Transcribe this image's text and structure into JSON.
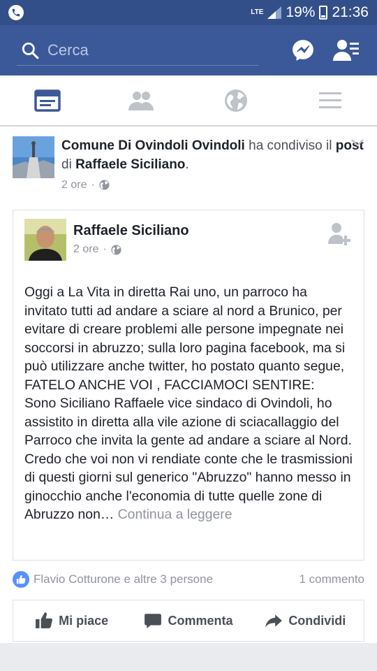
{
  "status_bar": {
    "network": "LTE",
    "battery": "19%",
    "time": "21:36"
  },
  "navbar": {
    "search_placeholder": "Cerca",
    "icons": [
      "search-icon",
      "messenger-icon",
      "friend-requests-icon"
    ]
  },
  "tabs": [
    {
      "name": "news-feed",
      "icon": "news-feed-icon",
      "active": true
    },
    {
      "name": "friends",
      "icon": "friends-icon",
      "active": false
    },
    {
      "name": "notifications",
      "icon": "globe-icon",
      "active": false
    },
    {
      "name": "menu",
      "icon": "menu-icon",
      "active": false
    }
  ],
  "story": {
    "page_name": "Comune Di Ovindoli Ovindoli",
    "verb_1": " ha condiviso il ",
    "object": "post",
    "verb_2": " di ",
    "original_author": "Raffaele Siciliano",
    "end": ".",
    "time": "2 ore",
    "privacy_icon": "public-globe-icon"
  },
  "shared_post": {
    "author": "Raffaele Siciliano",
    "time": "2 ore",
    "privacy_icon": "public-globe-icon",
    "body": "Oggi a La Vita in diretta Rai uno, un parroco ha invitato tutti ad andare a sciare al nord a Brunico, per evitare di creare problemi alle persone impegnate nei soccorsi in abruzzo; sulla loro pagina facebook, ma si può utilizzare anche twitter, ho postato quanto segue, FATELO ANCHE VOI , FACCIAMOCI SENTIRE:\nSono Siciliano Raffaele vice sindaco di Ovindoli, ho assistito in diretta alla vile azione di sciacallaggio del Parroco che invita la gente ad andare a sciare al Nord. Credo che voi non vi rendiate conte che le trasmissioni di questi giorni sul generico \"Abruzzo\" hanno messo in ginocchio anche l'economia di tutte quelle zone di Abruzzo non…",
    "continue_label": " Continua a leggere"
  },
  "reactions": {
    "likes_text": "Flavio Cotturone e altre 3 persone",
    "comments_text": "1 commento"
  },
  "actions": {
    "like_label": "Mi piace",
    "comment_label": "Commenta",
    "share_label": "Condividi"
  },
  "colors": {
    "brand": "#3b5998",
    "status_bar": "#334f8a",
    "meta_text": "#90949c",
    "like_badge": "#5890ff"
  }
}
